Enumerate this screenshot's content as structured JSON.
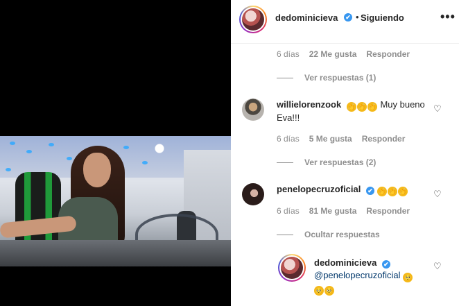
{
  "post": {
    "author": "dedominicieva",
    "follow_status": "Siguiendo",
    "separator": "•"
  },
  "comments": {
    "c0": {
      "time": "6 días",
      "likes": "22 Me gusta",
      "reply": "Responder",
      "view_replies": "Ver respuestas (1)"
    },
    "c1": {
      "user": "willielorenzook",
      "text_after": "Muy bueno Eva!!!",
      "time": "6 días",
      "likes": "5 Me gusta",
      "reply": "Responder",
      "view_replies": "Ver respuestas (2)"
    },
    "c2": {
      "user": "penelopecruzoficial",
      "time": "6 días",
      "likes": "81 Me gusta",
      "reply": "Responder",
      "hide_replies": "Ocultar respuestas"
    },
    "r1": {
      "user": "dedominicieva",
      "mention": "@penelopecruzoficial"
    }
  },
  "icons": {
    "verified": "✔",
    "more": "•••",
    "heart": "♡",
    "clap": "👏",
    "plead": "🥺"
  },
  "colors": {
    "accent_blue": "#3897f0",
    "muted": "#8e8e8e",
    "text": "#262626",
    "mention": "#00376b"
  }
}
